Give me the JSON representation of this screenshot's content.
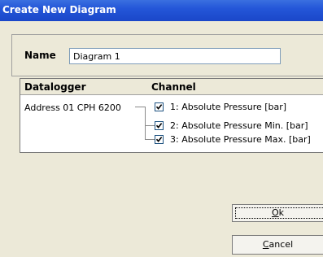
{
  "window": {
    "title": "Create New Diagram"
  },
  "name_group": {
    "label": "Name",
    "value": "Diagram 1"
  },
  "list": {
    "header_datalogger": "Datalogger",
    "header_channel": "Channel",
    "logger": "Address 01 CPH 6200",
    "channels": [
      {
        "label": "1: Absolute Pressure [bar]",
        "checked": true
      },
      {
        "label": "2: Absolute Pressure Min. [bar]",
        "checked": true
      },
      {
        "label": "3: Absolute Pressure Max. [bar]",
        "checked": true
      }
    ]
  },
  "buttons": {
    "ok": {
      "mnemonic": "O",
      "rest": "k"
    },
    "cancel": {
      "mnemonic": "C",
      "rest": "ancel"
    }
  }
}
